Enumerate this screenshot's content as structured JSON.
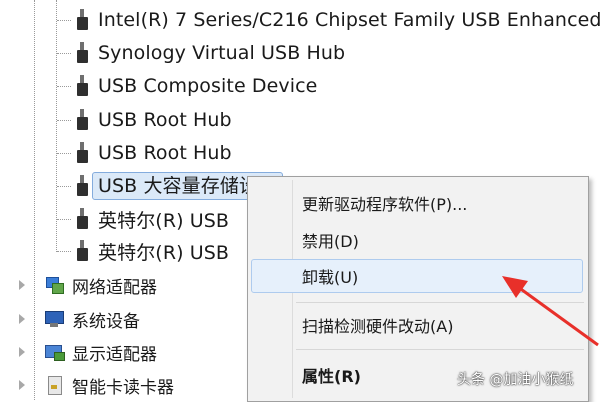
{
  "device_tree": {
    "usb_devices": [
      {
        "label": "Intel(R) 7 Series/C216 Chipset Family USB Enhanced"
      },
      {
        "label": "Synology Virtual USB Hub"
      },
      {
        "label": "USB Composite Device"
      },
      {
        "label": "USB Root Hub"
      },
      {
        "label": "USB Root Hub"
      },
      {
        "label": "USB 大容量存储设备",
        "selected": true
      },
      {
        "label": "英特尔(R) USB"
      },
      {
        "label": "英特尔(R) USB"
      }
    ],
    "categories": [
      {
        "label": "网络适配器",
        "icon": "network-adapter-icon"
      },
      {
        "label": "系统设备",
        "icon": "system-device-icon"
      },
      {
        "label": "显示适配器",
        "icon": "display-adapter-icon"
      },
      {
        "label": "智能卡读卡器",
        "icon": "smart-card-reader-icon"
      }
    ]
  },
  "context_menu": {
    "items": [
      {
        "label": "更新驱动程序软件(P)..."
      },
      {
        "label": "禁用(D)"
      },
      {
        "label": "卸载(U)",
        "highlighted": true
      },
      {
        "label": "扫描检测硬件改动(A)"
      },
      {
        "label": "属性(R)",
        "bold": true
      }
    ]
  },
  "annotation": {
    "arrow_color": "#e8302a"
  },
  "watermark": {
    "text": "头条 @加油小猴纸"
  }
}
